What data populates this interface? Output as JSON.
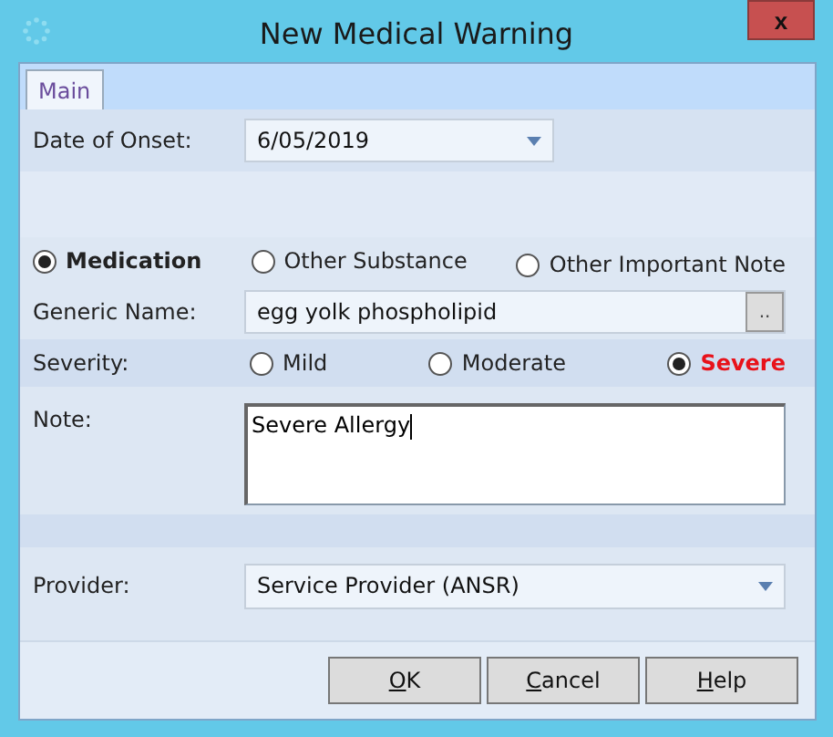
{
  "window": {
    "title": "New Medical Warning",
    "close": "x"
  },
  "tabs": [
    {
      "label": "Main",
      "selected": true
    }
  ],
  "date_of_onset": {
    "label": "Date of Onset:",
    "value": "6/05/2019"
  },
  "warning_types": [
    {
      "label": "Medication",
      "selected": true
    },
    {
      "label": "Other Substance",
      "selected": false
    },
    {
      "label": "Other Important Note",
      "selected": false
    }
  ],
  "generic_name": {
    "label": "Generic Name:",
    "value": "egg yolk phospholipid",
    "browse": ".."
  },
  "severity": {
    "label": "Severity:",
    "options": [
      {
        "label": "Mild",
        "selected": false
      },
      {
        "label": "Moderate",
        "selected": false
      },
      {
        "label": "Severe",
        "selected": true
      }
    ]
  },
  "note": {
    "label": "Note:",
    "value": "Severe Allergy"
  },
  "provider": {
    "label": "Provider:",
    "value": "Service Provider (ANSR)"
  },
  "buttons": [
    {
      "accel": "O",
      "rest": "K"
    },
    {
      "accel": "C",
      "rest": "ancel"
    },
    {
      "accel": "H",
      "rest": "elp"
    }
  ]
}
